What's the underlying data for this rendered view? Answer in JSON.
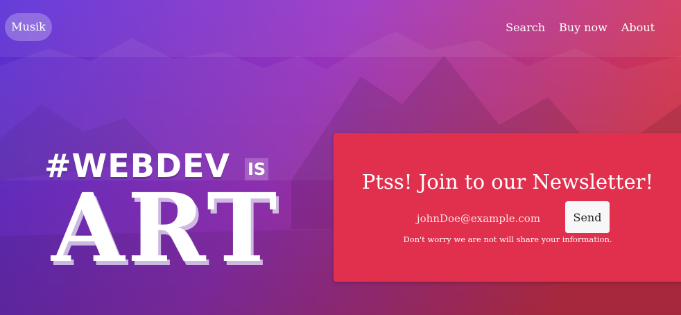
{
  "nav": {
    "brand": "Musik",
    "links": [
      "Search",
      "Buy now",
      "About"
    ]
  },
  "hero": {
    "line1": "#WEBDEV",
    "is": "IS",
    "art": "ART"
  },
  "newsletter": {
    "title": "Ptss! Join to our Newsletter!",
    "email_placeholder": "johnDoe@example.com",
    "send_label": "Send",
    "note": "Don't worry we are not will share your information."
  },
  "colors": {
    "gradient_left": "#5a2fd8",
    "gradient_mid": "#9c34c2",
    "gradient_right": "#d8344f",
    "card_background": "#e0304d",
    "button_background": "#f7f7f8"
  }
}
